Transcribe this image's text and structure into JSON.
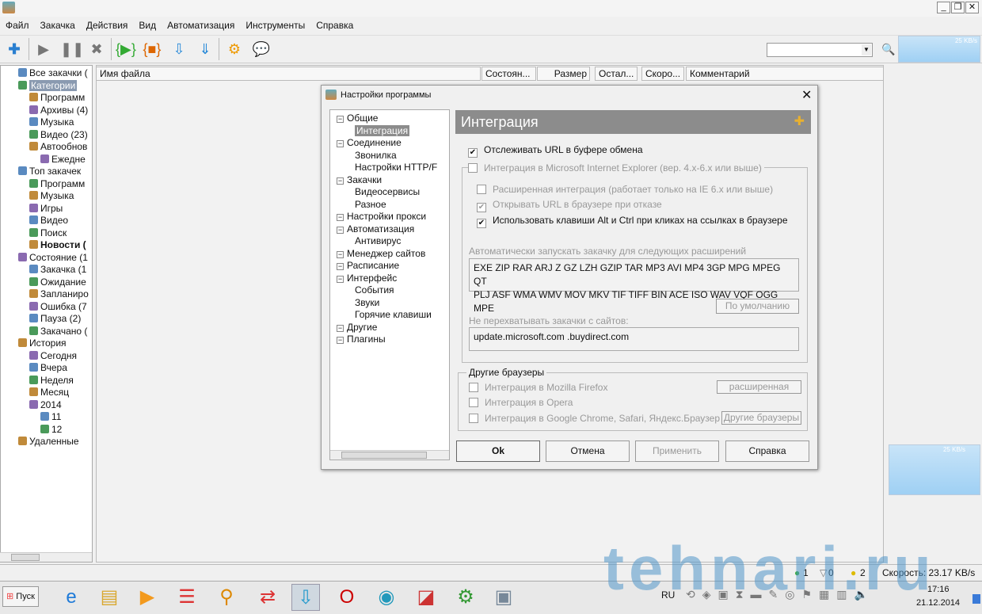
{
  "window": {
    "minimize": "_",
    "restore": "❐",
    "close": "✕"
  },
  "menu": [
    "Файл",
    "Закачка",
    "Действия",
    "Вид",
    "Автоматизация",
    "Инструменты",
    "Справка"
  ],
  "graph_top": "25 KB/s",
  "graph_side": "25 KB/s",
  "tree": [
    {
      "label": "Все закачки (",
      "level": 0
    },
    {
      "label": "Категории",
      "level": 0,
      "selected": true
    },
    {
      "label": "Программ",
      "level": 1
    },
    {
      "label": "Архивы (4)",
      "level": 1
    },
    {
      "label": "Музыка",
      "level": 1
    },
    {
      "label": "Видео (23)",
      "level": 1
    },
    {
      "label": "Автообнов",
      "level": 1
    },
    {
      "label": "Ежедне",
      "level": 2
    },
    {
      "label": "Топ закачек",
      "level": 0
    },
    {
      "label": "Программ",
      "level": 1
    },
    {
      "label": "Музыка",
      "level": 1
    },
    {
      "label": "Игры",
      "level": 1
    },
    {
      "label": "Видео",
      "level": 1
    },
    {
      "label": "Поиск",
      "level": 1
    },
    {
      "label": "Новости (",
      "level": 1,
      "bold": true
    },
    {
      "label": "Состояние (1",
      "level": 0
    },
    {
      "label": "Закачка (1",
      "level": 1
    },
    {
      "label": "Ожидание",
      "level": 1
    },
    {
      "label": "Запланиро",
      "level": 1
    },
    {
      "label": "Ошибка (7",
      "level": 1
    },
    {
      "label": "Пауза (2)",
      "level": 1
    },
    {
      "label": "Закачано (",
      "level": 1
    },
    {
      "label": "История",
      "level": 0
    },
    {
      "label": "Сегодня",
      "level": 1
    },
    {
      "label": "Вчера",
      "level": 1
    },
    {
      "label": "Неделя",
      "level": 1
    },
    {
      "label": "Месяц",
      "level": 1
    },
    {
      "label": "2014",
      "level": 1
    },
    {
      "label": "11",
      "level": 2
    },
    {
      "label": "12",
      "level": 2
    },
    {
      "label": "Удаленные",
      "level": 0
    }
  ],
  "columns": [
    "Имя файла",
    "Состоян...",
    "Размер",
    "Остал...",
    "Скоро...",
    "Комментарий"
  ],
  "dialog": {
    "title": "Настройки программы",
    "close": "✕",
    "tree": [
      {
        "label": "Общие",
        "level": 0
      },
      {
        "label": "Интеграция",
        "level": 1,
        "selected": true
      },
      {
        "label": "Соединение",
        "level": 0
      },
      {
        "label": "Звонилка",
        "level": 1
      },
      {
        "label": "Настройки HTTP/F",
        "level": 1
      },
      {
        "label": "Закачки",
        "level": 0
      },
      {
        "label": "Видеосервисы",
        "level": 1
      },
      {
        "label": "Разное",
        "level": 1
      },
      {
        "label": "Настройки прокси",
        "level": 0
      },
      {
        "label": "Автоматизация",
        "level": 0
      },
      {
        "label": "Антивирус",
        "level": 1
      },
      {
        "label": "Менеджер сайтов",
        "level": 0
      },
      {
        "label": "Расписание",
        "level": 0
      },
      {
        "label": "Интерфейс",
        "level": 0
      },
      {
        "label": "События",
        "level": 1
      },
      {
        "label": "Звуки",
        "level": 1
      },
      {
        "label": "Горячие клавиши",
        "level": 1
      },
      {
        "label": "Другие",
        "level": 0
      },
      {
        "label": "Плагины",
        "level": 0
      }
    ],
    "header": "Интеграция",
    "monitor_clipboard": "Отслеживать URL в буфере обмена",
    "ie_integration": "Интеграция в Microsoft Internet Explorer (вер. 4.x-6.x или выше)",
    "ie_extended": "Расширенная интеграция (работает только на IE 6.x или выше)",
    "ie_open_on_fail": "Открывать URL в браузере при отказе",
    "ie_alt_ctrl": "Использовать клавиши Alt и Ctrl при кликах на ссылках в браузере",
    "ext_label": "Автоматически запускать закачку для следующих расширений",
    "ext_line1": "EXE ZIP RAR ARJ Z GZ LZH GZIP TAR MP3 AVI MP4 3GP MPG MPEG QT",
    "ext_line2": "PLJ ASF WMA WMV MOV MKV TIF TIFF BIN ACE ISO WAV VQF OGG MPE",
    "default_btn": "По умолчанию",
    "skip_label": "Не перехватывать закачки с сайтов:",
    "skip_value": "update.microsoft.com .buydirect.com",
    "other_group": "Другие браузеры",
    "firefox": "Интеграция в Mozilla Firefox",
    "firefox_btn": "расширенная",
    "opera": "Интеграция в Opera",
    "chrome": "Интеграция в Google Chrome, Safari, Яндекс.Браузер",
    "other_btn": "Другие браузеры",
    "ok": "Ok",
    "cancel": "Отмена",
    "apply": "Применить",
    "help": "Справка"
  },
  "status": {
    "active": "1",
    "queued": "0",
    "paused": "2",
    "speed": "Скорость: 23.17 KB/s"
  },
  "taskbar": {
    "start": "Пуск",
    "lang": "RU",
    "time": "17:16",
    "date": "21.12.2014"
  },
  "watermark": "tehnari.ru"
}
